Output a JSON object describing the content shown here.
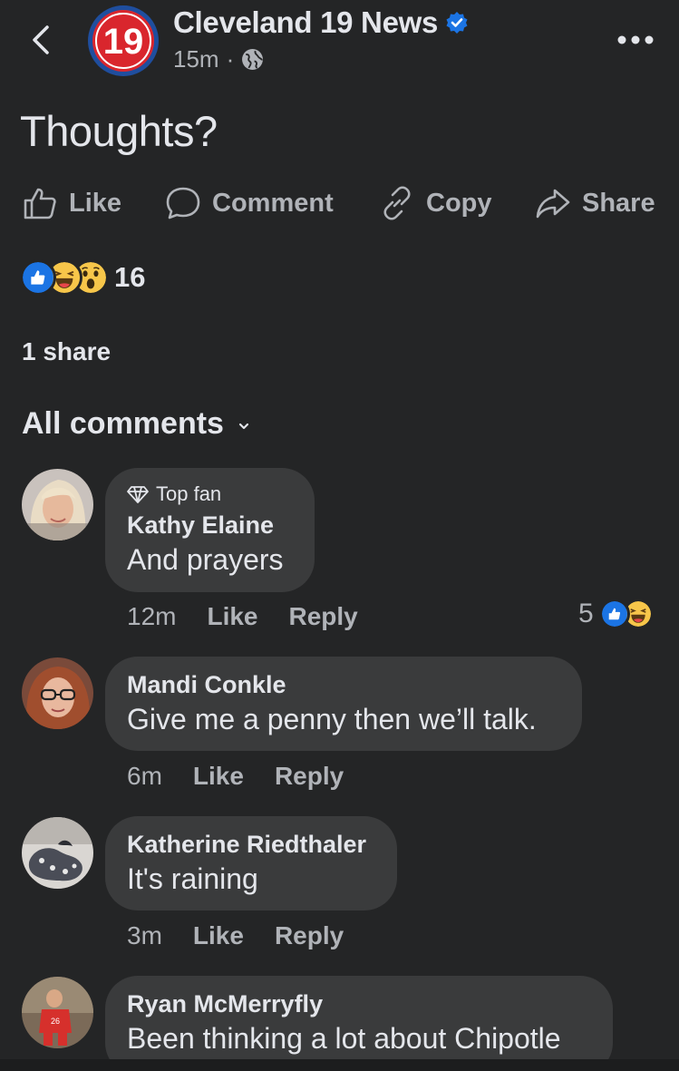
{
  "header": {
    "page_logo_text": "19",
    "page_name": "Cleveland 19 News",
    "timestamp": "15m",
    "separator": "·",
    "icons": [
      "back-icon",
      "verified-badge-icon",
      "globe-icon",
      "more-options-icon"
    ]
  },
  "post": {
    "text": "Thoughts?"
  },
  "actions": {
    "like": "Like",
    "comment": "Comment",
    "copy": "Copy",
    "share": "Share"
  },
  "reactions": {
    "types": [
      "like",
      "haha",
      "wow"
    ],
    "count": "16"
  },
  "shares": "1 share",
  "comments_filter": "All comments",
  "comments": [
    {
      "badge": "Top fan",
      "author": "Kathy Elaine",
      "text": "And prayers",
      "time": "12m",
      "like": "Like",
      "reply": "Reply",
      "reaction_count": "5",
      "reaction_types": [
        "like",
        "haha"
      ]
    },
    {
      "author": "Mandi Conkle",
      "text": "Give me a penny then we’ll talk.",
      "time": "6m",
      "like": "Like",
      "reply": "Reply"
    },
    {
      "author": "Katherine Riedthaler",
      "text": "It's raining",
      "time": "3m",
      "like": "Like",
      "reply": "Reply"
    },
    {
      "author": "Ryan McMerryfly",
      "text": "Been thinking a lot about Chipotle"
    }
  ],
  "colors": {
    "background": "#242526",
    "bubble": "#3a3b3c",
    "primary_text": "#e4e6eb",
    "secondary_text": "#b0b3b8",
    "facebook_blue": "#1b74e4",
    "logo_red": "#d9262d"
  }
}
